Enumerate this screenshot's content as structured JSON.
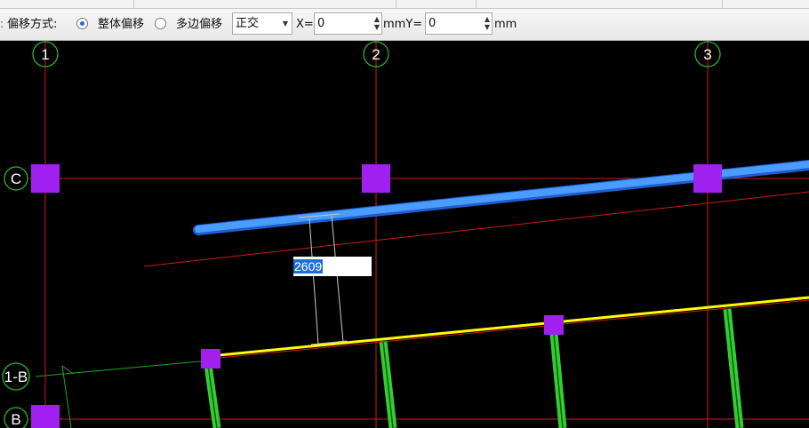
{
  "toolbar": {
    "offset_mode_label": "偏移方式:",
    "option_whole": "整体偏移",
    "option_multi": "多边偏移",
    "selected_option": "整体偏移",
    "mode_select_value": "正交",
    "x_label": "X=",
    "x_value": "0",
    "mm_y_label": "mmY=",
    "y_value": "0",
    "mm_label": "mm"
  },
  "axes": {
    "vertical": [
      "1",
      "2",
      "3"
    ],
    "horizontal": [
      "C",
      "1-B",
      "B"
    ]
  },
  "dimension_input": {
    "value": "2609"
  },
  "colors": {
    "background": "#000000",
    "grid_line": "#d01818",
    "column": "#a020f0",
    "selected_beam": "#3c8cff",
    "yellow_beam": "#ffff00",
    "green_member": "#33cc33",
    "axis_bubble": "#2db52d"
  }
}
